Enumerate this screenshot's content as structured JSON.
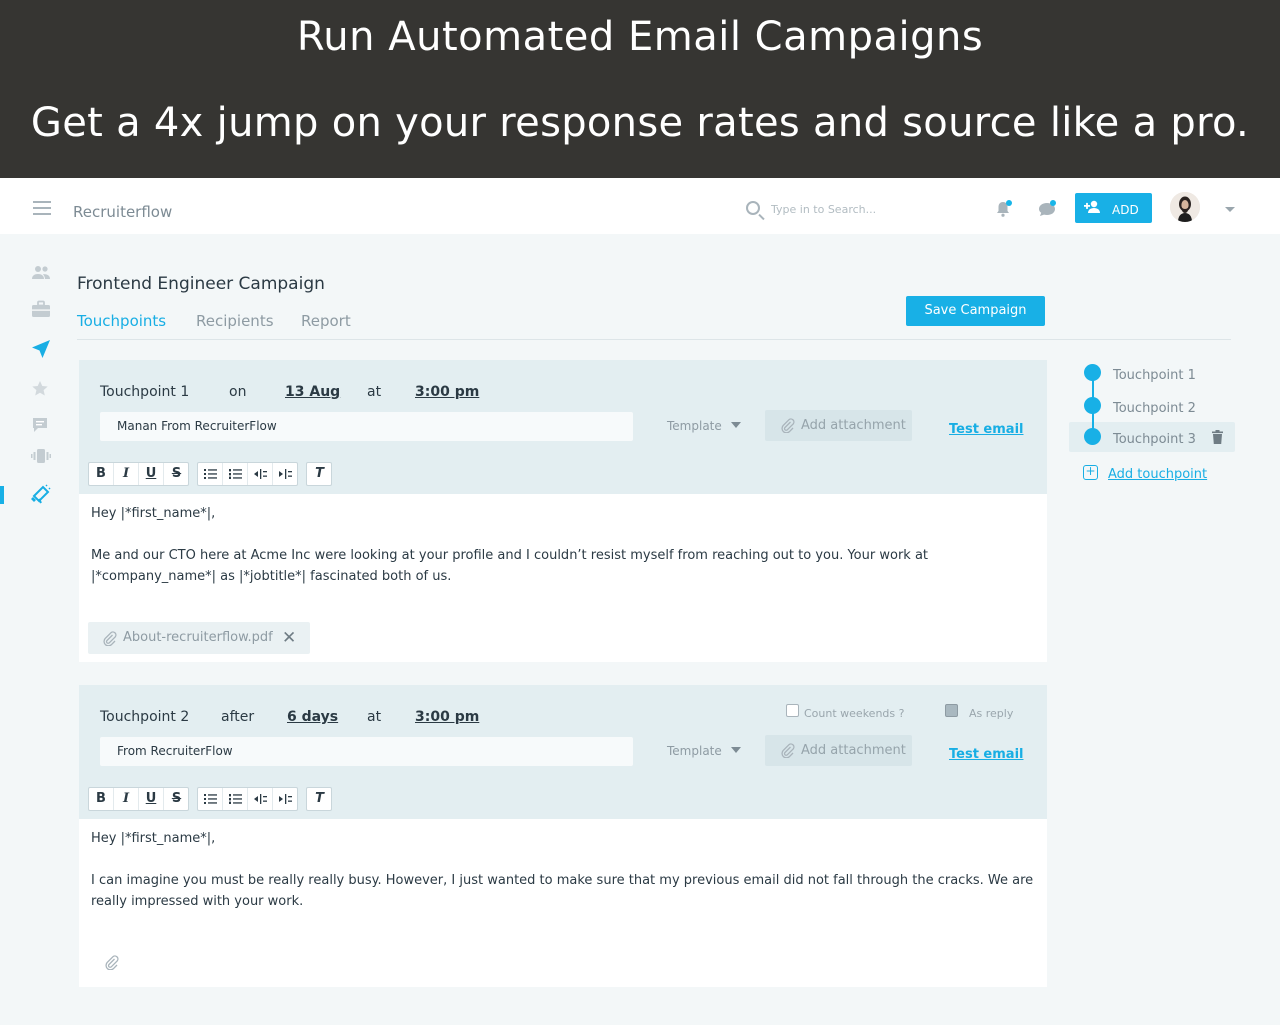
{
  "banner": {
    "headline": "Run Automated Email Campaigns",
    "subheadline": "Get a 4x jump on your response rates and source like a pro."
  },
  "topbar": {
    "app_name": "Recruiterflow",
    "search_placeholder": "Type in to Search...",
    "add_label": "ADD"
  },
  "page": {
    "title": "Frontend Engineer Campaign",
    "tabs": [
      "Touchpoints",
      "Recipients",
      "Report"
    ],
    "save_label": "Save Campaign"
  },
  "touchpoints": [
    {
      "name": "Touchpoint 1",
      "relation": "on",
      "when": "13 Aug",
      "at_label": "at",
      "time": "3:00 pm",
      "from": "Manan From RecruiterFlow",
      "template_label": "Template",
      "attach_label": "Add attachment",
      "test_label": "Test email",
      "body_line1": "Hey |*first_name*|,",
      "body_para": "Me and our CTO here at Acme Inc were looking at your profile and I couldn’t resist myself from reaching out to you. Your work at |*company_name*| as |*jobtitle*| fascinated both of us.",
      "attachment": "About-recruiterflow.pdf"
    },
    {
      "name": "Touchpoint 2",
      "relation": "after",
      "when": "6 days",
      "at_label": "at",
      "time": "3:00 pm",
      "count_weekends_label": "Count weekends ?",
      "as_reply_label": "As reply",
      "from": "From RecruiterFlow",
      "template_label": "Template",
      "attach_label": "Add attachment",
      "test_label": "Test email",
      "body_line1": "Hey |*first_name*|,",
      "body_para": "I can imagine you must be really really busy. However, I just wanted to make sure that my previous email did not fall through the cracks. We are really impressed with your work."
    }
  ],
  "timeline": {
    "items": [
      "Touchpoint 1",
      "Touchpoint 2",
      "Touchpoint 3"
    ],
    "add_label": "Add touchpoint"
  },
  "toolbar": {
    "bold": "B",
    "italic": "I",
    "underline": "U",
    "strike": "S",
    "clear": "T"
  },
  "colors": {
    "accent": "#18b0e6",
    "banner_bg": "#363532",
    "card_head": "#e3eef1"
  }
}
